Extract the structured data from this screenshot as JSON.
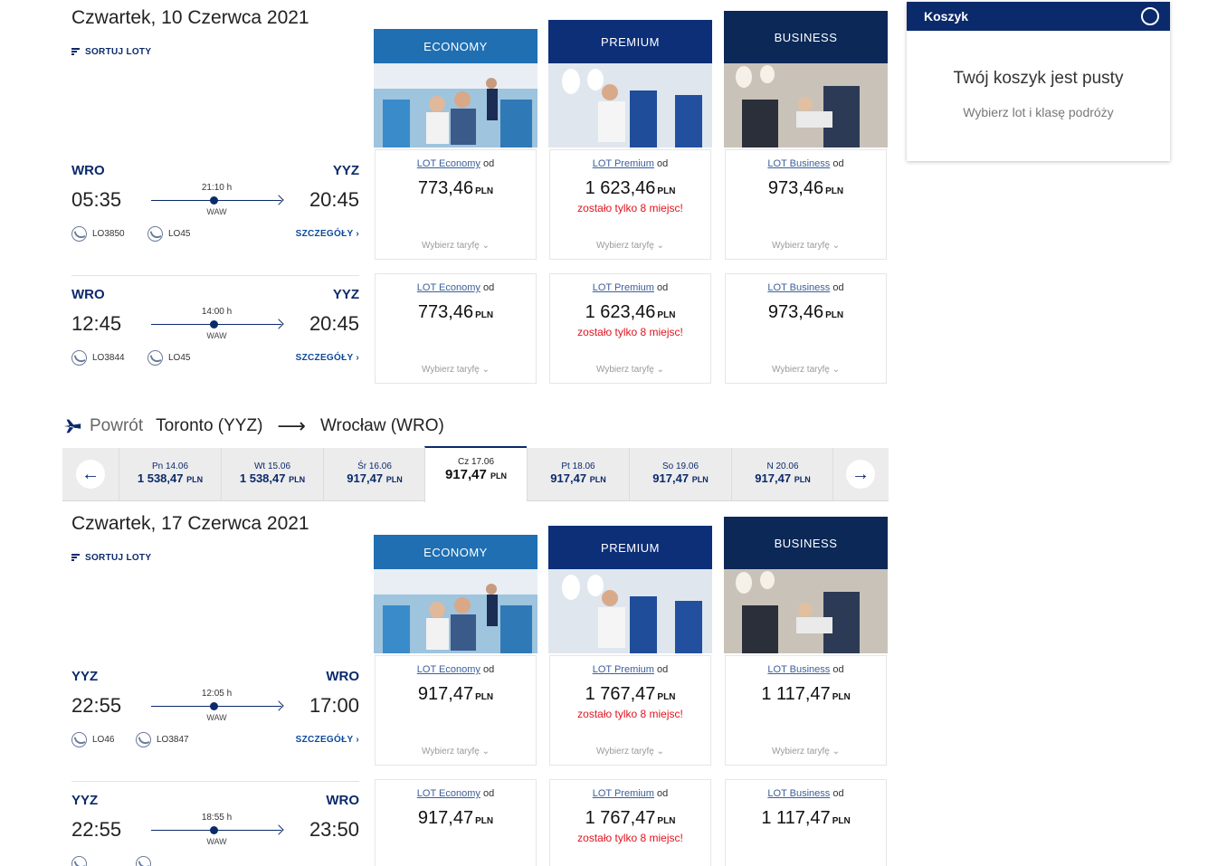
{
  "outbound": {
    "date_title": "Czwartek, 10 Czerwca 2021",
    "sort_label": "SORTUJ LOTY",
    "flights": [
      {
        "from": "WRO",
        "to": "YYZ",
        "dep": "05:35",
        "arr": "20:45",
        "duration": "21:10 h",
        "via": "WAW",
        "flight1": "LO3850",
        "flight2": "LO45",
        "details": "SZCZEGÓŁY ›",
        "fares": [
          {
            "label": "LOT Economy",
            "od": "od",
            "price": "773,46",
            "cur": "PLN",
            "warn": "",
            "choose": "Wybierz taryfę ⌄"
          },
          {
            "label": "LOT Premium",
            "od": "od",
            "price": "1 623,46",
            "cur": "PLN",
            "warn": "zostało tylko 8 miejsc!",
            "choose": "Wybierz taryfę ⌄"
          },
          {
            "label": "LOT Business",
            "od": "od",
            "price": "973,46",
            "cur": "PLN",
            "warn": "",
            "choose": "Wybierz taryfę ⌄"
          }
        ]
      },
      {
        "from": "WRO",
        "to": "YYZ",
        "dep": "12:45",
        "arr": "20:45",
        "duration": "14:00 h",
        "via": "WAW",
        "flight1": "LO3844",
        "flight2": "LO45",
        "details": "SZCZEGÓŁY ›",
        "fares": [
          {
            "label": "LOT Economy",
            "od": "od",
            "price": "773,46",
            "cur": "PLN",
            "warn": "",
            "choose": "Wybierz taryfę ⌄"
          },
          {
            "label": "LOT Premium",
            "od": "od",
            "price": "1 623,46",
            "cur": "PLN",
            "warn": "zostało tylko 8 miejsc!",
            "choose": "Wybierz taryfę ⌄"
          },
          {
            "label": "LOT Business",
            "od": "od",
            "price": "973,46",
            "cur": "PLN",
            "warn": "",
            "choose": "Wybierz taryfę ⌄"
          }
        ]
      }
    ]
  },
  "classes": [
    "ECONOMY",
    "PREMIUM",
    "BUSINESS"
  ],
  "cart": {
    "title": "Koszyk",
    "empty": "Twój koszyk jest pusty",
    "hint": "Wybierz lot i klasę podróży"
  },
  "return_header": {
    "label": "Powrót",
    "from": "Toronto (YYZ)",
    "arrow": "⟶",
    "to": "Wrocław (WRO)"
  },
  "carousel": [
    {
      "day": "Pn 14.06",
      "price": "1 538,47",
      "cur": "PLN"
    },
    {
      "day": "Wt 15.06",
      "price": "1 538,47",
      "cur": "PLN"
    },
    {
      "day": "Śr 16.06",
      "price": "917,47",
      "cur": "PLN"
    },
    {
      "day": "Cz 17.06",
      "price": "917,47",
      "cur": "PLN",
      "active": true
    },
    {
      "day": "Pt 18.06",
      "price": "917,47",
      "cur": "PLN"
    },
    {
      "day": "So 19.06",
      "price": "917,47",
      "cur": "PLN"
    },
    {
      "day": "N 20.06",
      "price": "917,47",
      "cur": "PLN"
    }
  ],
  "inbound": {
    "date_title": "Czwartek, 17 Czerwca 2021",
    "sort_label": "SORTUJ LOTY",
    "flights": [
      {
        "from": "YYZ",
        "to": "WRO",
        "dep": "22:55",
        "arr": "17:00",
        "duration": "12:05 h",
        "via": "WAW",
        "flight1": "LO46",
        "flight2": "LO3847",
        "details": "SZCZEGÓŁY ›",
        "fares": [
          {
            "label": "LOT Economy",
            "od": "od",
            "price": "917,47",
            "cur": "PLN",
            "warn": "",
            "choose": "Wybierz taryfę ⌄"
          },
          {
            "label": "LOT Premium",
            "od": "od",
            "price": "1 767,47",
            "cur": "PLN",
            "warn": "zostało tylko 8 miejsc!",
            "choose": "Wybierz taryfę ⌄"
          },
          {
            "label": "LOT Business",
            "od": "od",
            "price": "1 117,47",
            "cur": "PLN",
            "warn": "",
            "choose": "Wybierz taryfę ⌄"
          }
        ]
      },
      {
        "from": "YYZ",
        "to": "WRO",
        "dep": "22:55",
        "arr": "23:50",
        "duration": "18:55 h",
        "via": "WAW",
        "flight1": "",
        "flight2": "",
        "details": "",
        "fares": [
          {
            "label": "LOT Economy",
            "od": "od",
            "price": "917,47",
            "cur": "PLN",
            "warn": "",
            "choose": ""
          },
          {
            "label": "LOT Premium",
            "od": "od",
            "price": "1 767,47",
            "cur": "PLN",
            "warn": "zostało tylko 8 miejsc!",
            "choose": ""
          },
          {
            "label": "LOT Business",
            "od": "od",
            "price": "1 117,47",
            "cur": "PLN",
            "warn": "",
            "choose": ""
          }
        ]
      }
    ]
  },
  "colors": {
    "economy": "#1f6fb2",
    "premium": "#0c2f78",
    "business": "#0b2857",
    "brand": "#0b2a6b",
    "warn": "#e0141e"
  }
}
